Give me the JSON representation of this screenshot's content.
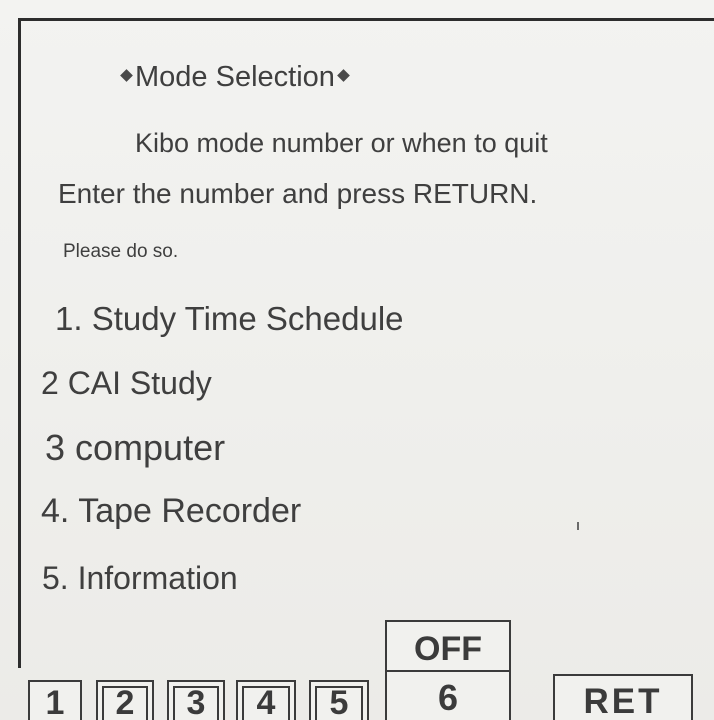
{
  "title": "Mode Selection",
  "instructions": {
    "line1": "Kibo mode number or when to quit",
    "line2": "Enter the number and press RETURN.",
    "line3": "Please do so."
  },
  "menu": [
    {
      "label": "1. Study Time Schedule"
    },
    {
      "label": "2 CAI Study"
    },
    {
      "label": "3 computer"
    },
    {
      "label": "4. Tape Recorder"
    },
    {
      "label": "5. Information"
    }
  ],
  "keys": {
    "k1": "1",
    "k2": "2",
    "k3": "3",
    "k4": "4",
    "k5": "5",
    "off": "OFF",
    "k6": "6",
    "ret": "RET"
  }
}
